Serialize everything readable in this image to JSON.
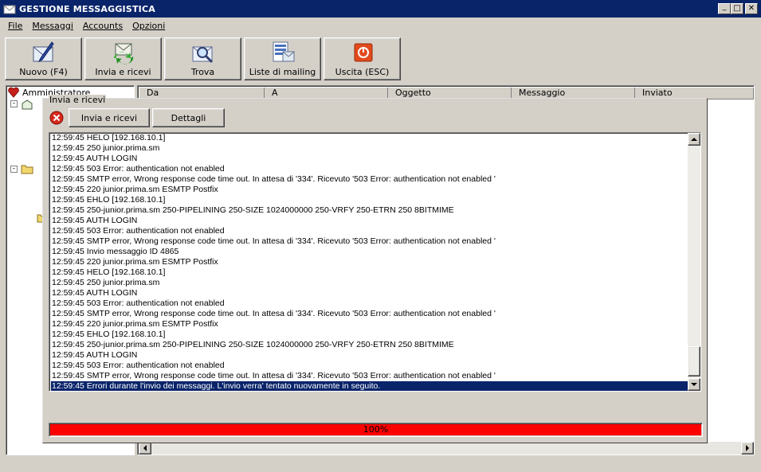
{
  "window": {
    "title": "GESTIONE MESSAGGISTICA",
    "icon": "envelope-icon"
  },
  "window_controls": {
    "minimize": "_",
    "maximize": "□",
    "close": "✕"
  },
  "menu": [
    {
      "label": "File"
    },
    {
      "label": "Messaggi"
    },
    {
      "label": "Accounts"
    },
    {
      "label": "Opzioni"
    }
  ],
  "toolbar": [
    {
      "label": "Nuovo (F4)",
      "icon": "new-message-icon"
    },
    {
      "label": "Invia e ricevi",
      "icon": "send-receive-icon"
    },
    {
      "label": "Trova",
      "icon": "find-icon"
    },
    {
      "label": "Liste di mailing",
      "icon": "mailing-list-icon"
    },
    {
      "label": "Uscita (ESC)",
      "icon": "exit-icon"
    }
  ],
  "tree": {
    "root_label": "Amministratore"
  },
  "grid": {
    "columns": [
      "Da",
      "A",
      "Oggetto",
      "Messaggio",
      "Inviato"
    ]
  },
  "dialog": {
    "title": "Invia e ricevi",
    "send_receive_button": "Invia e ricevi",
    "details_button": "Dettagli",
    "log": [
      "12:59:45 HELO [192.168.10.1]",
      "12:59:45 250 junior.prima.sm",
      "12:59:45 AUTH LOGIN",
      "12:59:45 503 Error: authentication not enabled",
      "12:59:45 SMTP error, Wrong response code time out. In attesa di '334'. Ricevuto '503 Error: authentication not enabled '",
      "12:59:45 220 junior.prima.sm ESMTP Postfix",
      "12:59:45 EHLO [192.168.10.1]",
      "12:59:45 250-junior.prima.sm 250-PIPELINING 250-SIZE 1024000000 250-VRFY 250-ETRN 250 8BITMIME",
      "12:59:45 AUTH LOGIN",
      "12:59:45 503 Error: authentication not enabled",
      "12:59:45 SMTP error, Wrong response code time out. In attesa di '334'. Ricevuto '503 Error: authentication not enabled '",
      "12:59:45 Invio messaggio ID 4865",
      "12:59:45 220 junior.prima.sm ESMTP Postfix",
      "12:59:45 HELO [192.168.10.1]",
      "12:59:45 250 junior.prima.sm",
      "12:59:45 AUTH LOGIN",
      "12:59:45 503 Error: authentication not enabled",
      "12:59:45 SMTP error, Wrong response code time out. In attesa di '334'. Ricevuto '503 Error: authentication not enabled '",
      "12:59:45 220 junior.prima.sm ESMTP Postfix",
      "12:59:45 EHLO [192.168.10.1]",
      "12:59:45 250-junior.prima.sm 250-PIPELINING 250-SIZE 1024000000 250-VRFY 250-ETRN 250 8BITMIME",
      "12:59:45 AUTH LOGIN",
      "12:59:45 503 Error: authentication not enabled",
      "12:59:45 SMTP error, Wrong response code time out. In attesa di '334'. Ricevuto '503 Error: authentication not enabled '",
      "12:59:45 Errori durante l'invio dei messaggi. L'invio verra' tentato nuovamente in seguito."
    ],
    "selected_log_index": 24,
    "progress": {
      "value": 100,
      "label": "100%",
      "color": "#ff0000"
    }
  },
  "colors": {
    "titlebar": "#0a246a",
    "selection": "#0a246a",
    "face": "#d4d0c8"
  }
}
